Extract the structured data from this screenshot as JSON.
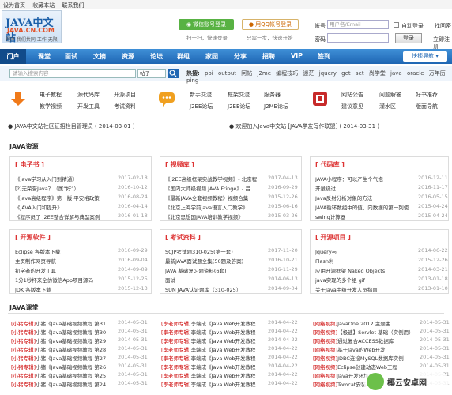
{
  "topbar": [
    "设为首页",
    "收藏本站",
    "联系我们"
  ],
  "logo": {
    "big": "JAVA中文站",
    "url": "JAVA.CN.COM",
    "slogan": "程序 我们共同 工作 无限"
  },
  "social": {
    "wechat_btn": "微信账号登录",
    "wechat_sub": "扫一扫，快速登录",
    "qq_btn": "用QQ帐号登录",
    "qq_sub": "只需一步，快速开始"
  },
  "login": {
    "account_label": "帐号",
    "account_placeholder": "用户名/Email",
    "auto_login": "自动登录",
    "register": "找回密",
    "password_label": "密码",
    "login_btn": "登录",
    "join": "立即注册"
  },
  "nav": {
    "home": "门户",
    "items": [
      "课堂",
      "面试",
      "文摘",
      "资源",
      "论坛",
      "群组",
      "家园",
      "分享",
      "招聘",
      "VIP",
      "签到"
    ],
    "quick": "快捷导航 ▾"
  },
  "search": {
    "placeholder": "请输入搜索内容",
    "select": "帖子",
    "hot_label": "热搜:",
    "hot": [
      "poi",
      "output",
      "阿帖",
      "j2me",
      "编程技巧",
      "迷茫",
      "jquery",
      "get",
      "set",
      "尚学堂",
      "java",
      "oracle",
      "万年历",
      "ping"
    ]
  },
  "quick": {
    "g1": [
      "电子教程",
      "源代码库",
      "开源项目",
      "教学视频",
      "开发工具",
      "考试资料"
    ],
    "g2": [
      "新手交流",
      "框架交流",
      "服务器",
      "J2EE论坛",
      "J2EE论坛",
      "J2ME论坛"
    ],
    "g3": [
      "网站公告",
      "问题解答",
      "好书推荐",
      "建议意见",
      "灌水区",
      "版面导航"
    ]
  },
  "announce": {
    "left": "JAVA中文站社区征招栏目管理员 ( 2014-03-01 )",
    "right": "欢迎加入Java中文站 [JAVA学友写作联盟] ( 2014-03-31 )"
  },
  "section1": "JAVA资源",
  "panels_top": [
    {
      "title": "[ 电子书 ]",
      "rows": [
        [
          "《Java学习从入门到精通》",
          "2017-02-18"
        ],
        [
          "[?]无荣誉Java？（属“好”）",
          "2016-10-12"
        ],
        [
          "《Java高级程序》第一版 平安格政策",
          "2016-08-24"
        ],
        [
          "《JAVA入门和提升》",
          "2016-04-14"
        ],
        [
          "《程序员了 J2EE整合详解与典型案例",
          "2016-01-18"
        ]
      ]
    },
    {
      "title": "[ 视频库 ]",
      "rows": [
        [
          "《J2EE高级框架实战教学视频》- 北京程",
          "2017-04-13"
        ],
        [
          "《国内大师级视频 JAVA Fringe》- 吕",
          "2016-09-29"
        ],
        [
          "《最新JAVA全套视频教程》视频合集",
          "2015-12-26"
        ],
        [
          "《北京上海学前java语言入门教学》",
          "2015-06-16"
        ],
        [
          "《北京思想国JAVA培训教学视频》",
          "2015-03-26"
        ]
      ]
    },
    {
      "title": "[ 代码库 ]",
      "rows": [
        [
          "JAVA小程序：可以产生个气泡",
          "2016-12-11"
        ],
        [
          "开量绕过",
          "2016-11-17"
        ],
        [
          "Java反射分析对象的方法",
          "2016-05-15"
        ],
        [
          "JAVA循环数组中的值，向数据的第一列使",
          "2015-04-24"
        ],
        [
          "swing计算器",
          "2015-04-24"
        ]
      ]
    }
  ],
  "panels_mid": [
    {
      "title": "[ 开源软件 ]",
      "rows": [
        [
          "Eclipse 各版本下载",
          "2016-09-29"
        ],
        [
          "主页制作网页导航",
          "2016-09-04"
        ],
        [
          "初学者的开发工具",
          "2014-09-09"
        ],
        [
          "1分1秒杯来全仿微信App项目源码",
          "2015-12-25"
        ],
        [
          "JDK 各版本下载",
          "2015-12-13"
        ]
      ]
    },
    {
      "title": "[ 考试资料 ]",
      "rows": [
        [
          "SCJP考试题310-025(第一套)",
          "2017-11-20"
        ],
        [
          "最新JAVA面试题全集(50题及答案)",
          "2016-10-21"
        ],
        [
          "JAVA 基础复习题资料(6套)",
          "2016-11-29"
        ],
        [
          "面试",
          "2014-06-13"
        ],
        [
          "SUN JAVA认证题库（310-025）",
          "2014-09-04"
        ]
      ]
    },
    {
      "title": "[ 开源项目 ]",
      "rows": [
        [
          "Jquery与",
          "2014-06-22"
        ],
        [
          "Flash利",
          "2015-12-26"
        ],
        [
          "应用开源框架 Naked Objects",
          "2014-03-21"
        ],
        [
          "java实现的多个组 gif",
          "2013-01-18"
        ],
        [
          "关于Java中级开发人员指南",
          "2013-01-10"
        ]
      ]
    }
  ],
  "section2": "JAVA课堂",
  "lessons": {
    "left": [
      [
        "[小猪专辑]",
        "小猪《Java基础视频教程 第31",
        "2014-05-31"
      ],
      [
        "[小猪专辑]",
        "小猪《Java基础视频教程 第30",
        "2014-05-31"
      ],
      [
        "[小猪专辑]",
        "小猪《Java基础视频教程 第29",
        "2014-05-31"
      ],
      [
        "[小猪专辑]",
        "小猪《Java基础视频教程 第28",
        "2014-05-31"
      ],
      [
        "[小猪专辑]",
        "小猪《Java基础视频教程 第27",
        "2014-05-31"
      ],
      [
        "[小猪专辑]",
        "小猪《Java基础视频教程 第26",
        "2014-05-31"
      ],
      [
        "[小猪专辑]",
        "小猪《Java基础视频教程 第25",
        "2014-05-31"
      ],
      [
        "[小猪专辑]",
        "小猪《Java基础视频教程 第24",
        "2014-05-31"
      ]
    ],
    "mid": [
      [
        "[李老师专辑]",
        "李端成《Java Web开发教程",
        "2014-04-22"
      ],
      [
        "[李老师专辑]",
        "李端成《Java Web开发教程",
        "2014-04-22"
      ],
      [
        "[李老师专辑]",
        "李端成《Java Web开发教程",
        "2014-04-22"
      ],
      [
        "[李老师专辑]",
        "李端成《Java Web开发教程",
        "2014-04-22"
      ],
      [
        "[李老师专辑]",
        "李端成《Java Web开发教程",
        "2014-04-22"
      ],
      [
        "[李老师专辑]",
        "李端成《Java Web开发教程",
        "2014-04-22"
      ],
      [
        "[李老师专辑]",
        "李端成《Java Web开发教程",
        "2014-04-22"
      ],
      [
        "[李老师专辑]",
        "李端成《Java Web开发教程",
        "2014-04-22"
      ]
    ],
    "right": [
      [
        "[网络视频]",
        "JavaOne 2012 主题曲",
        "2014-05-31"
      ],
      [
        "[网络视频]",
        "【极速】Servlet 基础（实例用）",
        "2014-05-31"
      ],
      [
        "[网络视频]",
        "通过复合ACCESS数据库",
        "2014-05-31"
      ],
      [
        "[网络视频]",
        "基于Java的Web开发",
        "2014-05-31"
      ],
      [
        "[网络视频]",
        "JDBC连接MySQL数据库实例",
        "2014-05-31"
      ],
      [
        "[网络视频]",
        "Eclipse创建动态Web工程",
        "2014-05-31"
      ],
      [
        "[网络视频]",
        "Java开发环境配置",
        "2014-05-31"
      ],
      [
        "[网络视频]",
        "Tomcat安装与配置",
        "2014-05-31"
      ]
    ]
  },
  "watermark": "椰云安卓网"
}
